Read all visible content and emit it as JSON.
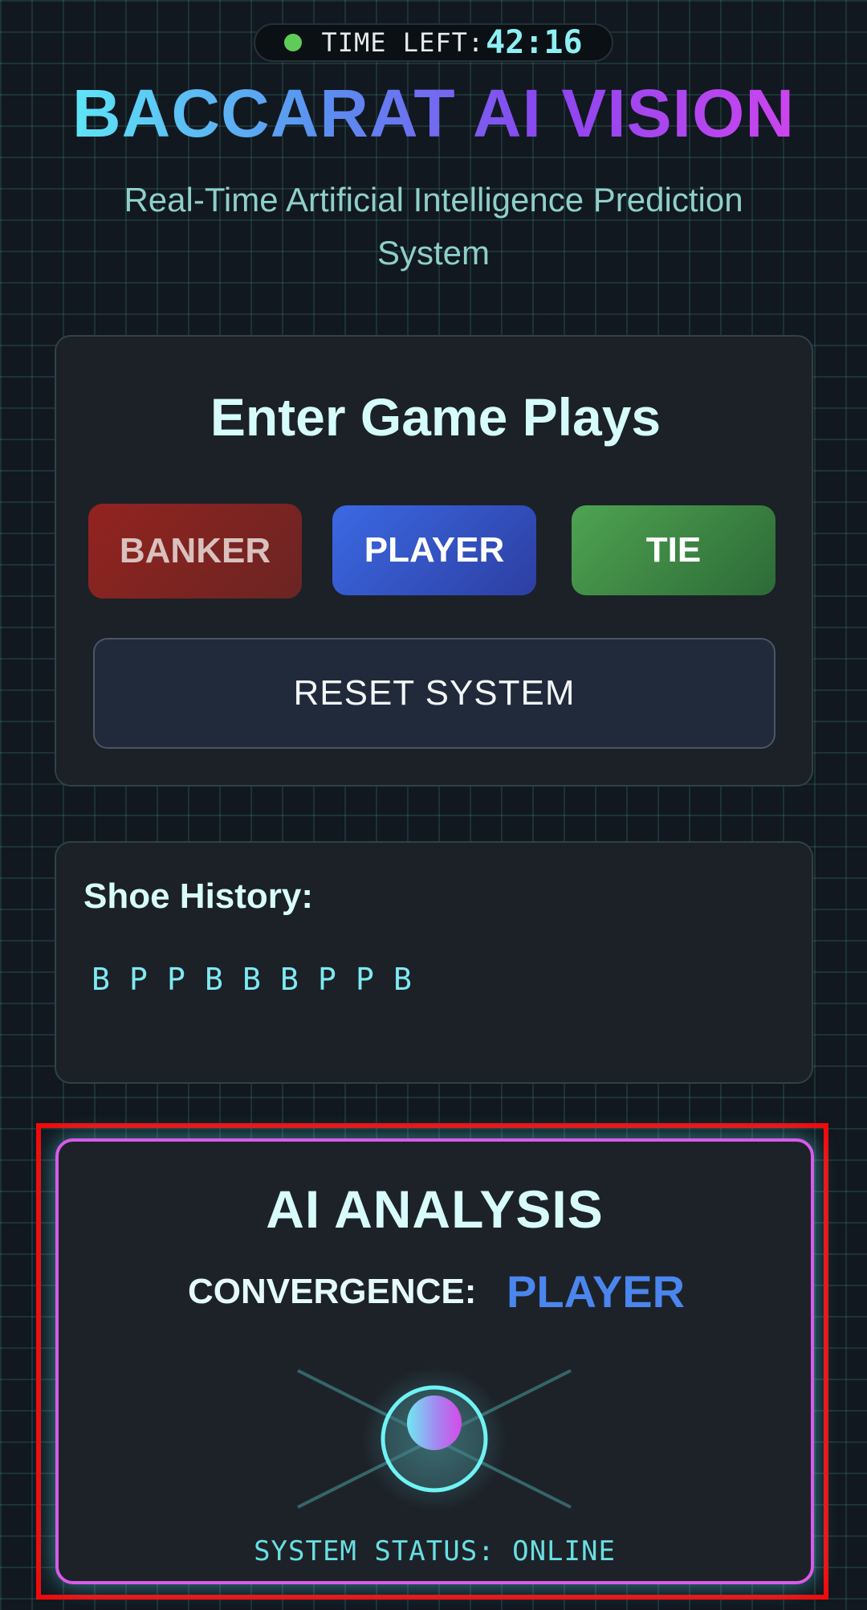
{
  "timer": {
    "label": "TIME LEFT:",
    "value": "42:16"
  },
  "header": {
    "title": "BACCARAT AI VISION",
    "subtitle": "Real-Time Artificial Intelligence Prediction System"
  },
  "entry": {
    "heading": "Enter Game Plays",
    "buttons": {
      "banker": "BANKER",
      "player": "PLAYER",
      "tie": "TIE"
    },
    "reset": "RESET SYSTEM"
  },
  "history": {
    "heading": "Shoe History:",
    "items": [
      "B",
      "P",
      "P",
      "B",
      "B",
      "B",
      "P",
      "P",
      "B"
    ]
  },
  "analysis": {
    "heading": "AI ANALYSIS",
    "convergence_label": "CONVERGENCE:",
    "convergence_value": "PLAYER",
    "status": "SYSTEM STATUS: ONLINE"
  },
  "colors": {
    "banker": "#93231f",
    "player": "#3b69e3",
    "tie": "#4ea351",
    "accent_cyan": "#5ee6f7",
    "accent_magenta": "#d95ae8",
    "highlight_red": "#f00b0b"
  },
  "icons": {
    "timer": "green-dot-icon",
    "orb": "ai-orb-icon"
  }
}
